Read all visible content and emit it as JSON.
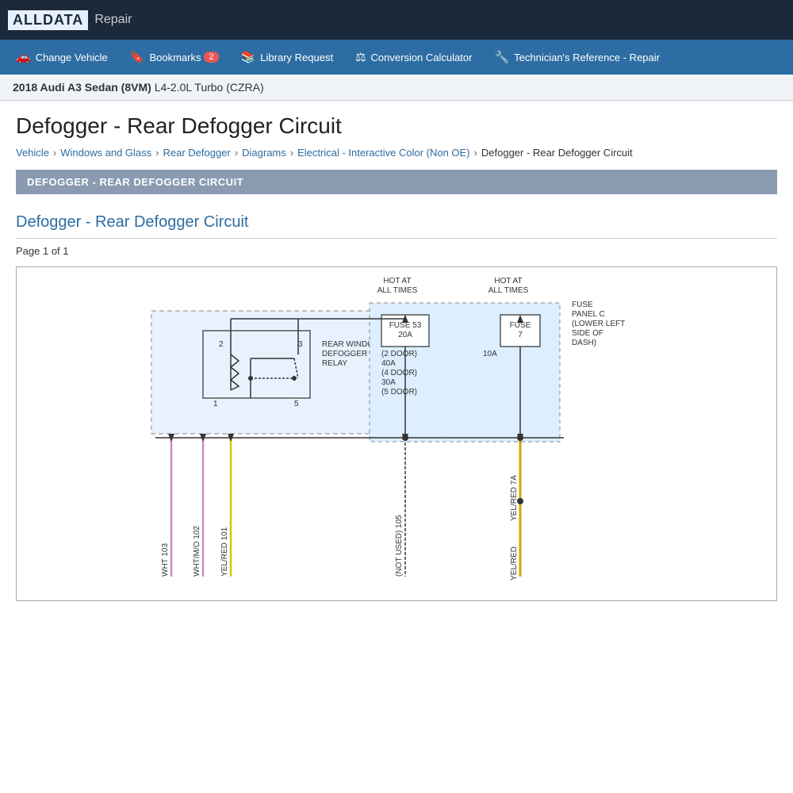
{
  "header": {
    "logo": "ALLDATA",
    "logo_suffix": "Repair"
  },
  "menu": {
    "items": [
      {
        "id": "change-vehicle",
        "icon": "🚗",
        "label": "Change Vehicle",
        "badge": null
      },
      {
        "id": "bookmarks",
        "icon": "🔖",
        "label": "Bookmarks",
        "badge": "2"
      },
      {
        "id": "library-request",
        "icon": "📚",
        "label": "Library Request",
        "badge": null
      },
      {
        "id": "conversion-calculator",
        "icon": "⚖",
        "label": "Conversion Calculator",
        "badge": null
      },
      {
        "id": "technicians-reference",
        "icon": "🔧",
        "label": "Technician's Reference - Repair",
        "badge": null
      }
    ]
  },
  "vehicle": {
    "year_make_model": "2018 Audi A3 Sedan (8VM)",
    "engine": "L4-2.0L Turbo (CZRA)"
  },
  "page": {
    "title": "Defogger - Rear Defogger Circuit",
    "section_header": "DEFOGGER - REAR DEFOGGER CIRCUIT"
  },
  "breadcrumb": {
    "items": [
      {
        "label": "Vehicle",
        "link": true
      },
      {
        "label": "Windows and Glass",
        "link": true
      },
      {
        "label": "Rear Defogger",
        "link": true
      },
      {
        "label": "Diagrams",
        "link": true
      },
      {
        "label": "Electrical - Interactive Color (Non OE)",
        "link": true
      },
      {
        "label": "Defogger - Rear Defogger Circuit",
        "link": false
      }
    ]
  },
  "diagram": {
    "title": "Defogger - Rear Defogger Circuit",
    "page_info": "Page 1 of 1"
  }
}
